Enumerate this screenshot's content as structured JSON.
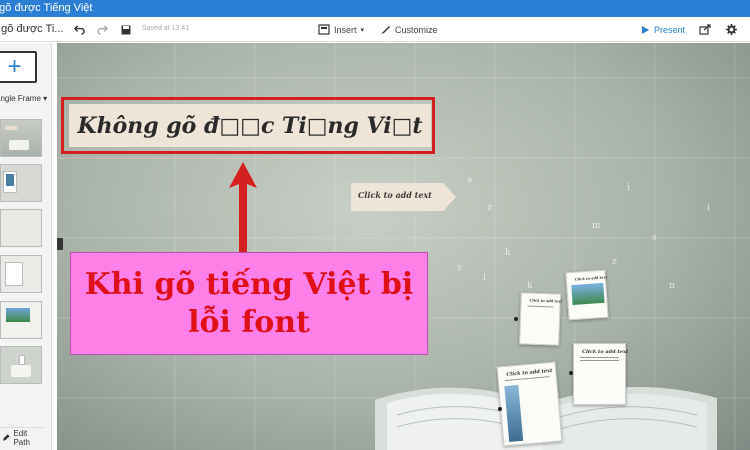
{
  "window": {
    "title": "g gõ được Tiếng Việt"
  },
  "toolbar": {
    "doc_title": "g gõ được Ti...",
    "undo_icon": "undo-icon",
    "redo_icon": "redo-icon",
    "save_icon": "save-icon",
    "saved_status": "Saved at 13:41",
    "insert_label": "Insert",
    "customize_label": "Customize",
    "present_label": "Present",
    "share_icon": "share-icon",
    "settings_icon": "gear-icon"
  },
  "sidebar": {
    "add_frame_label": "+",
    "frame_type_label": "angle Frame",
    "frame_type_arrow": "▾",
    "edit_path_label": "Edit Path"
  },
  "canvas": {
    "title_text": "Không gõ đ□□c Ti□ng Vi□t",
    "ribbon_text": "Click to add text",
    "callout_line1": "Khi gõ tiếng Việt bị",
    "callout_line2": "lỗi font",
    "paper_card_1": "Click to add text",
    "paper_card_2": "Click to add text",
    "paper_card_3": "Click to add text",
    "paper_card_4": "Click to add text",
    "scatter_letters": [
      "a",
      "z",
      "i",
      "m",
      "k",
      "s",
      "l",
      "k",
      "z",
      "s",
      "n",
      "i"
    ]
  },
  "colors": {
    "accent_blue": "#2a7fd4",
    "highlight_red": "#d42020",
    "callout_pink": "#ff7fe8",
    "callout_text_red": "#e0101a"
  }
}
